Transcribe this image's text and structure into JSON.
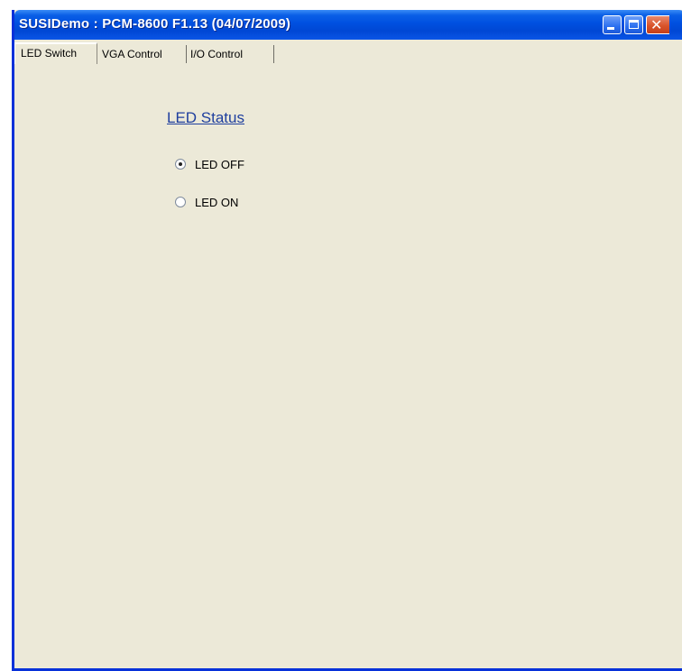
{
  "window": {
    "title": "SUSIDemo : PCM-8600 F1.13 (04/07/2009)",
    "buttons": {
      "minimize": "minimize-icon",
      "maximize": "maximize-icon",
      "close": "close-icon"
    },
    "colors": {
      "titlebar": "#0050e0",
      "client_bg": "#ece9d8",
      "close_button": "#d9542b"
    }
  },
  "tabs": [
    {
      "label": "LED Switch",
      "active": true
    },
    {
      "label": "VGA Control",
      "active": false
    },
    {
      "label": "I/O Control",
      "active": false
    }
  ],
  "led_panel": {
    "heading": "LED Status",
    "options": [
      {
        "label": "LED OFF",
        "selected": true
      },
      {
        "label": "LED ON",
        "selected": false
      }
    ]
  }
}
